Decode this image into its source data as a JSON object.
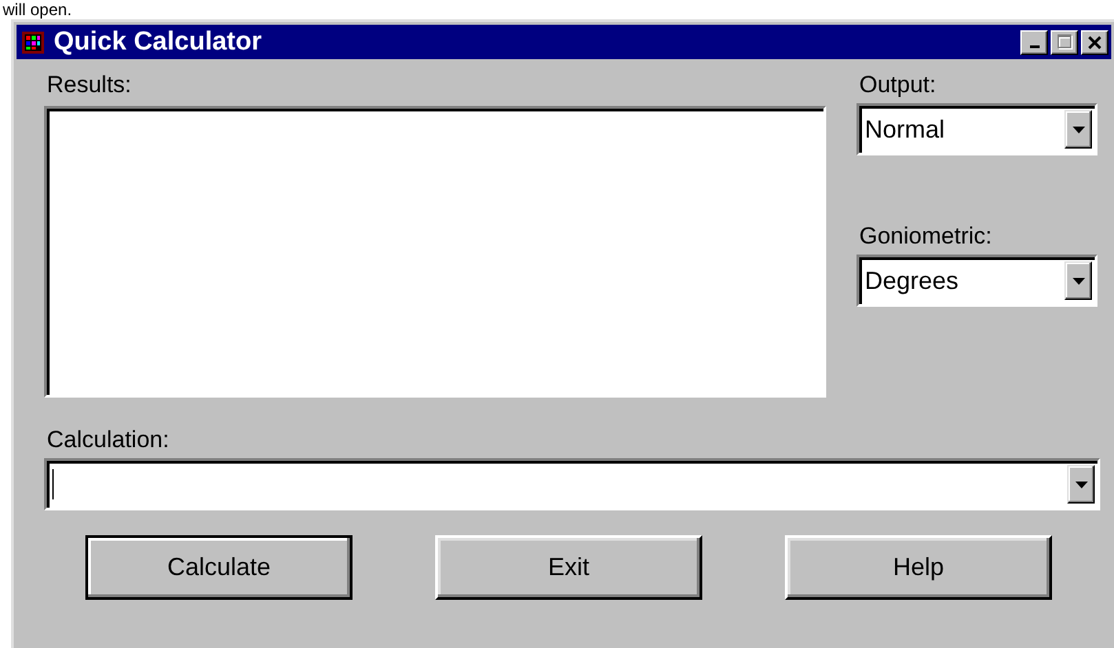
{
  "caption": "will open.",
  "window": {
    "title": "Quick Calculator"
  },
  "title_buttons": [
    {
      "kind": "minimize",
      "disabled": false
    },
    {
      "kind": "maximize",
      "disabled": true
    },
    {
      "kind": "close",
      "disabled": false
    }
  ],
  "results": {
    "label": "Results:"
  },
  "output": {
    "label": "Output:",
    "value": "Normal"
  },
  "goniometric": {
    "label": "Goniometric:",
    "value": "Degrees"
  },
  "calculation": {
    "label": "Calculation:",
    "focused": true
  },
  "buttons": [
    {
      "label": "Calculate",
      "default": true
    },
    {
      "label": "Exit",
      "default": false
    },
    {
      "label": "Help",
      "default": false
    }
  ]
}
